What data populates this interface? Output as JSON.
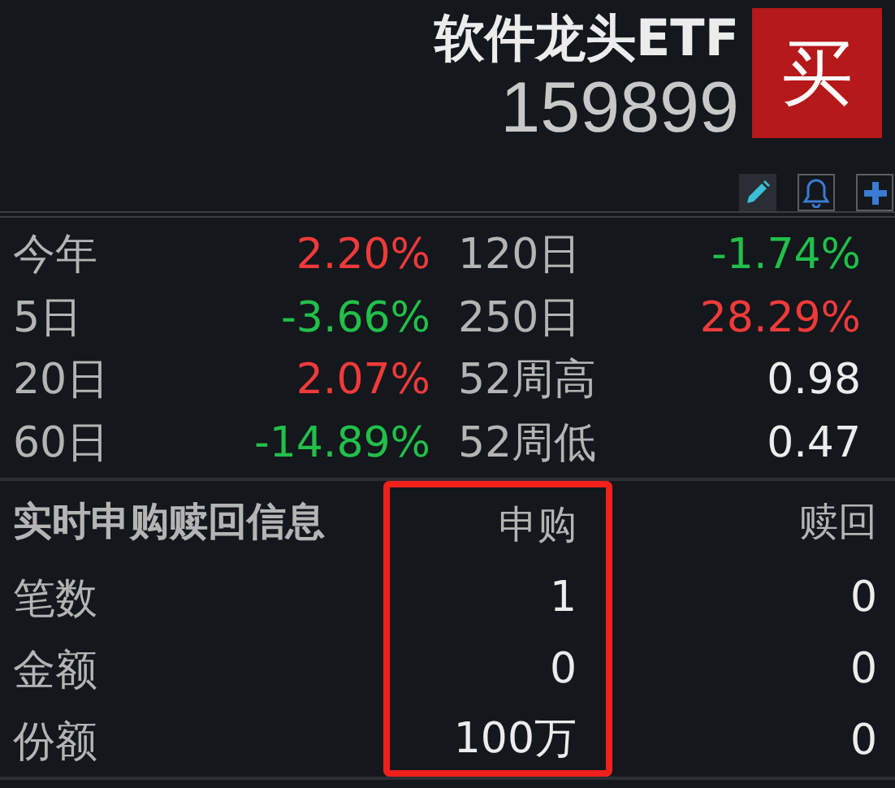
{
  "header": {
    "name": "软件龙头ETF",
    "code": "159899",
    "buy_button": "买"
  },
  "toolbar": [
    {
      "kind": "edit"
    },
    {
      "kind": "alert"
    },
    {
      "kind": "add"
    }
  ],
  "stats": [
    [
      {
        "label": "今年",
        "value": "2.20%",
        "color": "#f03a3a"
      },
      {
        "label": "120日",
        "value": "-1.74%",
        "color": "#22c04a"
      }
    ],
    [
      {
        "label": "5日",
        "value": "-3.66%",
        "color": "#22c04a"
      },
      {
        "label": "250日",
        "value": "28.29%",
        "color": "#f03a3a"
      }
    ],
    [
      {
        "label": "20日",
        "value": "2.07%",
        "color": "#f03a3a"
      },
      {
        "label": "52周高",
        "value": "0.98",
        "color": "#ececec"
      }
    ],
    [
      {
        "label": "60日",
        "value": "-14.89%",
        "color": "#22c04a"
      },
      {
        "label": "52周低",
        "value": "0.47",
        "color": "#ececec"
      }
    ]
  ],
  "flow_table": {
    "title": "实时申购赎回信息",
    "columns": [
      {
        "label": "申购",
        "highlighted": true
      },
      {
        "label": "赎回",
        "highlighted": false
      }
    ],
    "rows": [
      {
        "label": "笔数",
        "values": [
          "1",
          "0"
        ]
      },
      {
        "label": "金额",
        "values": [
          "0",
          "0"
        ]
      },
      {
        "label": "份额",
        "values": [
          "100万",
          "0"
        ]
      }
    ]
  }
}
